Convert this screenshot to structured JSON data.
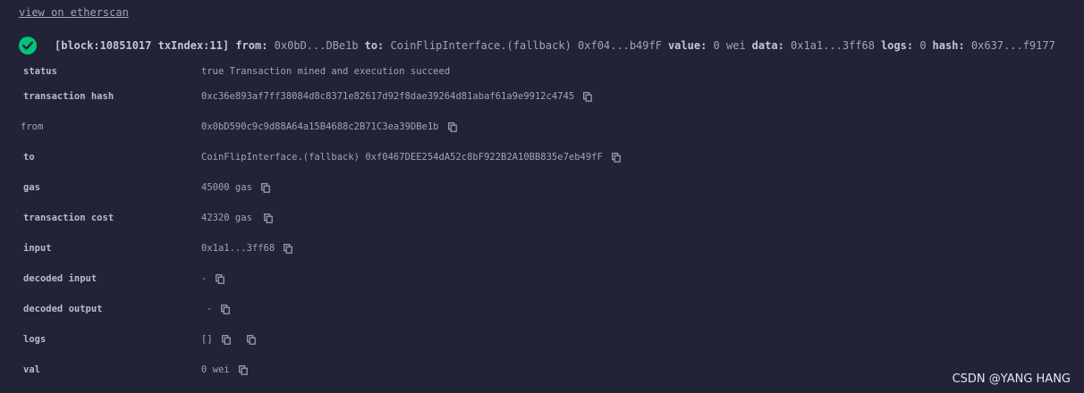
{
  "link": {
    "etherscan": "view on etherscan"
  },
  "summary": {
    "block": "[block:10851017 txIndex:11]",
    "from_label": "from:",
    "from_value": "0x0bD...DBe1b",
    "to_label": "to:",
    "to_value": "CoinFlipInterface.(fallback) 0xf04...b49fF",
    "value_label": "value:",
    "value_value": "0 wei",
    "data_label": "data:",
    "data_value": "0x1a1...3ff68",
    "logs_label": "logs:",
    "logs_value": "0",
    "hash_label": "hash:",
    "hash_value": "0x637...f9177"
  },
  "rows": {
    "status": {
      "label": "status",
      "value": "true Transaction mined and execution succeed"
    },
    "transaction_hash": {
      "label": "transaction hash",
      "value": "0xc36e893af7ff38084d8c8371e82617d92f8dae39264d81abaf61a9e9912c4745"
    },
    "from": {
      "label": "from",
      "value": "0x0bD590c9c9d88A64a15B4688c2B71C3ea39DBe1b"
    },
    "to": {
      "label": "to",
      "value": "CoinFlipInterface.(fallback) 0xf0467DEE254dA52c8bF922B2A10BB835e7eb49fF"
    },
    "gas": {
      "label": "gas",
      "value": "45000 gas"
    },
    "transaction_cost": {
      "label": "transaction cost",
      "value": "42320 gas"
    },
    "input": {
      "label": "input",
      "value": "0x1a1...3ff68"
    },
    "decoded_input": {
      "label": "decoded input",
      "value": "-"
    },
    "decoded_output": {
      "label": "decoded output",
      "value": "-"
    },
    "logs": {
      "label": "logs",
      "value": "[]"
    },
    "val": {
      "label": "val",
      "value": "0 wei"
    }
  },
  "watermark": "CSDN @YANG HANG",
  "colors": {
    "background": "#222336",
    "text": "#a2a3bd",
    "success": "#00c57a"
  }
}
